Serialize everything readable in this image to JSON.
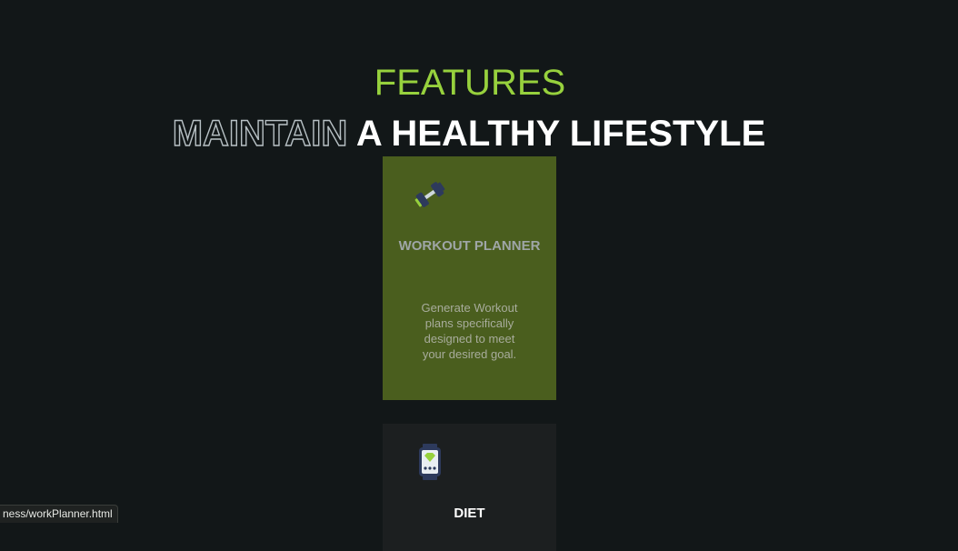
{
  "features": {
    "label": "FEATURES",
    "headline_outline": "MAINTAIN",
    "headline_rest": " A HEALTHY LIFESTYLE"
  },
  "cards": [
    {
      "icon": "dumbbell-icon",
      "title": "WORKOUT PLANNER",
      "text": "Generate Workout plans specifically designed to meet your desired goal."
    },
    {
      "icon": "smartwatch-icon",
      "title": "DIET"
    }
  ],
  "status_bar": {
    "url": "ness/workPlanner.html"
  },
  "colors": {
    "background": "#121718",
    "accent_green": "#97d13d",
    "workout_card": "#4a5e1e",
    "diet_card": "#1c1f20"
  }
}
